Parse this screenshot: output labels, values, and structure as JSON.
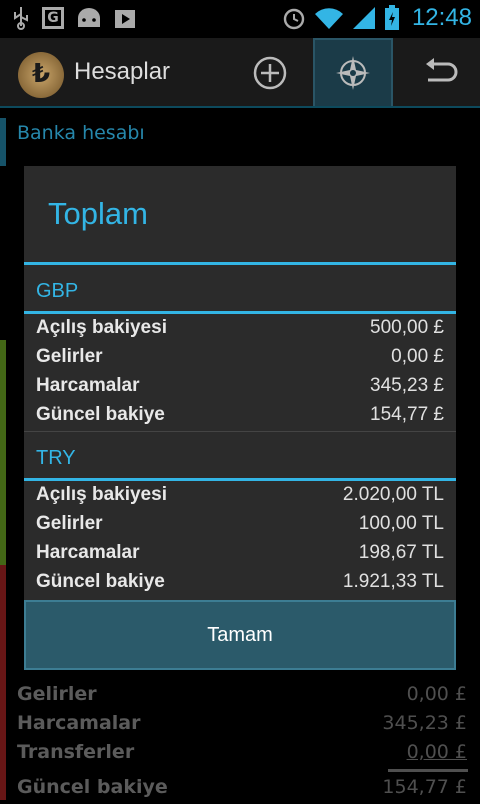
{
  "status_bar": {
    "time": "12:48",
    "icons": [
      "usb-icon",
      "g-notification-icon",
      "android-icon",
      "play-store-icon",
      "alarm-icon",
      "wifi-icon",
      "signal-icon",
      "battery-charging-icon"
    ]
  },
  "action_bar": {
    "title": "Hesaplar",
    "logo_glyph": "₺",
    "actions": [
      "add-icon",
      "compass-icon",
      "back-icon"
    ]
  },
  "background_list": {
    "section_title": "Banka hesabı",
    "rows": [
      {
        "label": "Gelirler",
        "value": "0,00 £"
      },
      {
        "label": "Harcamalar",
        "value": "345,23 £"
      },
      {
        "label": "Transferler",
        "value": "0,00 £"
      },
      {
        "label": "Güncel bakiye",
        "value": "154,77 £"
      }
    ]
  },
  "dialog": {
    "title": "Toplam",
    "groups": [
      {
        "currency": "GBP",
        "rows": [
          {
            "label": "Açılış bakiyesi",
            "value": "500,00 £"
          },
          {
            "label": "Gelirler",
            "value": "0,00 £"
          },
          {
            "label": "Harcamalar",
            "value": "345,23 £"
          },
          {
            "label": "Güncel bakiye",
            "value": "154,77 £"
          }
        ]
      },
      {
        "currency": "TRY",
        "rows": [
          {
            "label": "Açılış bakiyesi",
            "value": "2.020,00 TL"
          },
          {
            "label": "Gelirler",
            "value": "100,00 TL"
          },
          {
            "label": "Harcamalar",
            "value": "198,67 TL"
          },
          {
            "label": "Güncel bakiye",
            "value": "1.921,33 TL"
          }
        ]
      }
    ],
    "ok_button": "Tamam"
  },
  "colors": {
    "accent": "#33b5e5",
    "dialog_bg": "#2b2b2b",
    "button_bg": "#2b5a6a",
    "stripe_green": "#5a8a1e",
    "stripe_red": "#8a1e1e",
    "stripe_blue": "#1e6f8c"
  }
}
